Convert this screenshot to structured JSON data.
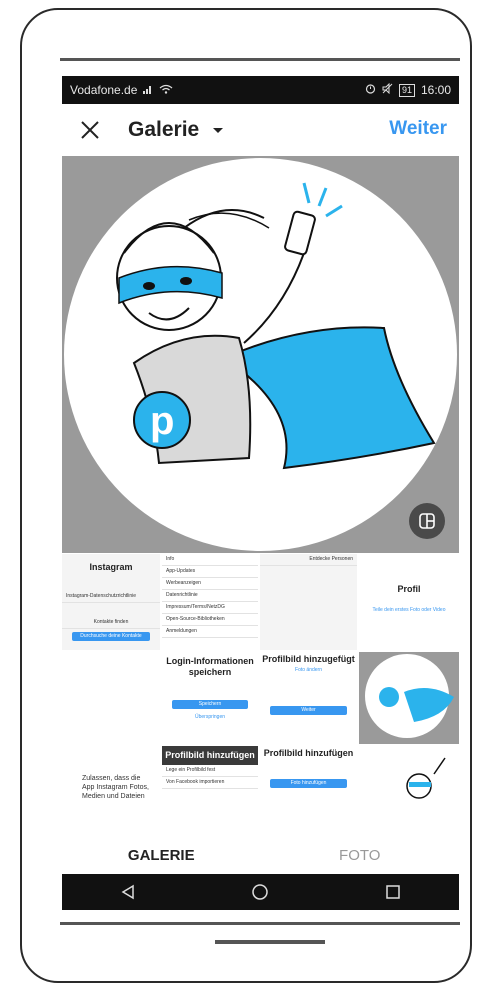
{
  "status_bar": {
    "carrier": "Vodafone.de",
    "battery": "91",
    "time": "16:00"
  },
  "app_bar": {
    "title": "Galerie",
    "next_label": "Weiter"
  },
  "thumbnails": [
    {
      "id": "t1",
      "lines": [
        "Instagram",
        "Instagram-Datenschutzrichtlinie",
        "Kontakte finden",
        "Durchsuche deine Kontakte"
      ]
    },
    {
      "id": "t2",
      "lines": [
        "Info",
        "App-Updates",
        "Werbeanzeigen",
        "Datenrichtlinie",
        "Impressum/Terms/NetzDG",
        "Open-Source-Bibliotheken",
        "Anmeldungen"
      ]
    },
    {
      "id": "t3",
      "lines": [
        "Entdecke Personen"
      ]
    },
    {
      "id": "t4",
      "lines": [
        "Profil",
        "Teile dein erstes Foto oder Video"
      ]
    },
    {
      "id": "t5",
      "lines": [
        "Login-Informationen speichern",
        "Speichern",
        "Überspringen"
      ]
    },
    {
      "id": "t6",
      "lines": [
        "Profilbild hinzugefügt",
        "Foto ändern",
        "Weiter"
      ]
    },
    {
      "id": "t8",
      "lines": [
        "Zulassen, dass die App Instagram Fotos, Medien und Dateien"
      ]
    },
    {
      "id": "t9",
      "lines": [
        "Profilbild hinzufügen",
        "Lege ein Profilbild fest",
        "Von Facebook importieren"
      ]
    },
    {
      "id": "t10",
      "lines": [
        "Profilbild hinzufügen",
        "Foto hinzufügen"
      ]
    }
  ],
  "tabs": {
    "gallery": "GALERIE",
    "photo": "FOTO"
  },
  "colors": {
    "accent": "#3897f0",
    "hero_blue": "#2bb3ec"
  },
  "icons": [
    "close-icon",
    "chevron-down-icon",
    "crop-toggle-icon",
    "back-icon",
    "home-icon",
    "recents-icon",
    "wifi-icon",
    "signal-icon",
    "alarm-icon",
    "mute-icon"
  ]
}
